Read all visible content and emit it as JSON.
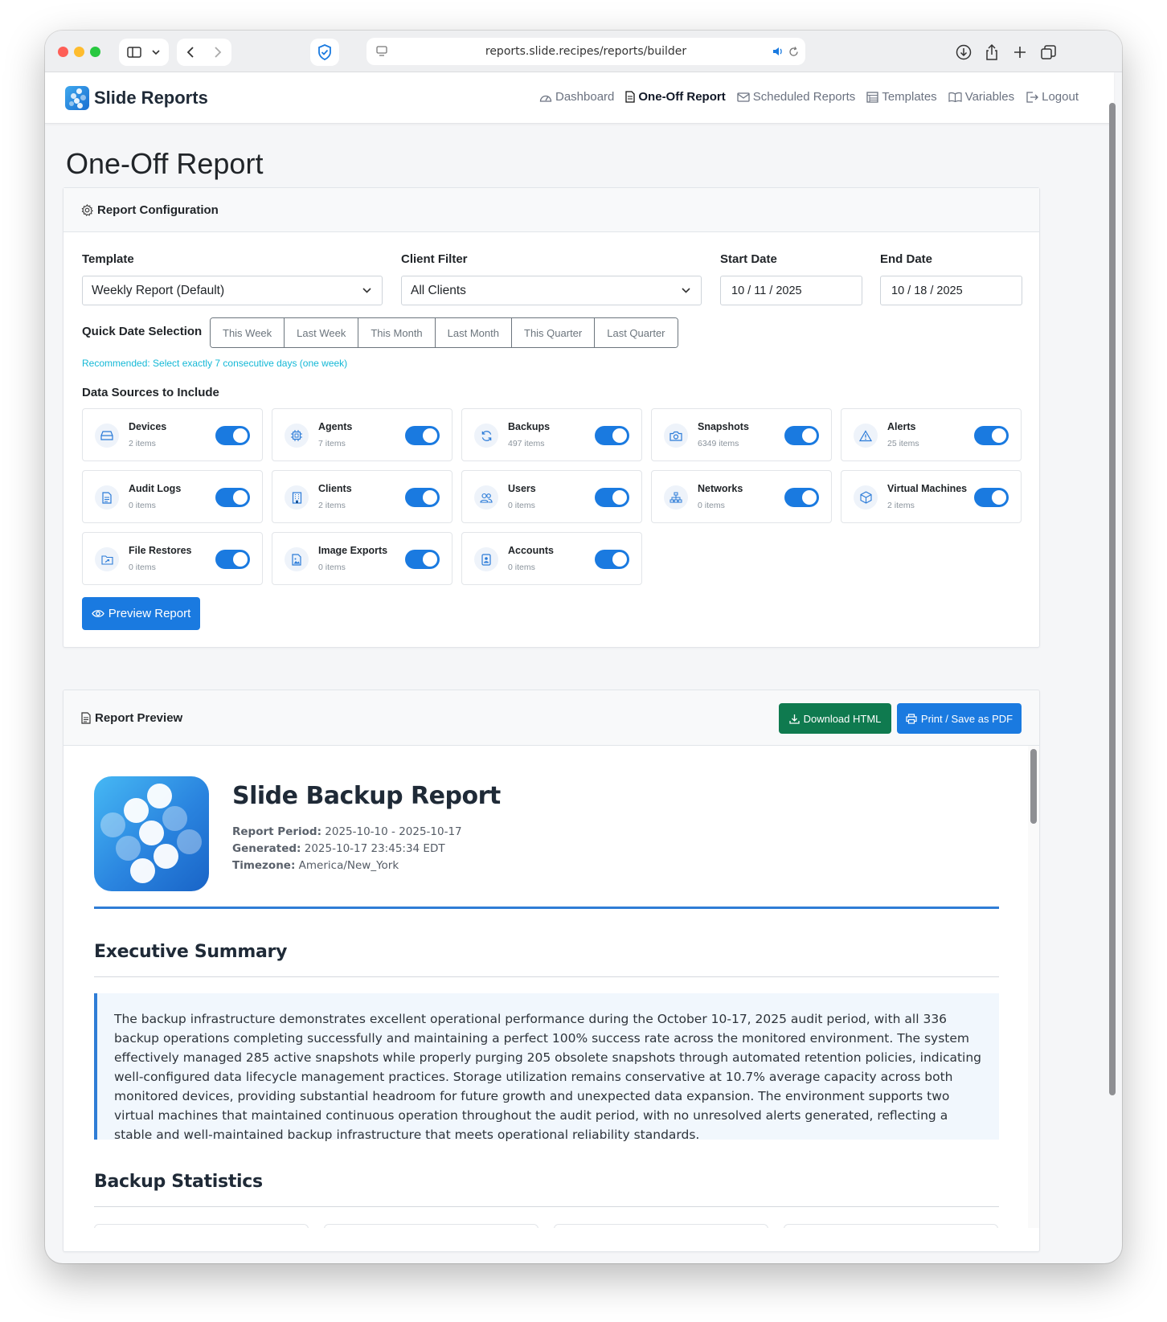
{
  "browser": {
    "url": "reports.slide.recipes/reports/builder"
  },
  "app": {
    "brand": "Slide Reports",
    "nav": [
      {
        "label": "Dashboard",
        "icon": "dashboard-icon"
      },
      {
        "label": "One-Off Report",
        "icon": "file-icon",
        "active": true
      },
      {
        "label": "Scheduled Reports",
        "icon": "envelope-icon"
      },
      {
        "label": "Templates",
        "icon": "table-icon"
      },
      {
        "label": "Variables",
        "icon": "book-icon"
      },
      {
        "label": "Logout",
        "icon": "logout-icon"
      }
    ]
  },
  "page": {
    "title": "One-Off Report"
  },
  "config": {
    "header": "Report Configuration",
    "template_label": "Template",
    "template_value": "Weekly Report (Default)",
    "client_label": "Client Filter",
    "client_value": "All Clients",
    "start_label": "Start Date",
    "start_value": "10 / 11 / 2025",
    "end_label": "End Date",
    "end_value": "10 / 18 / 2025",
    "quick_label": "Quick Date Selection",
    "quick_options": [
      "This Week",
      "Last Week",
      "This Month",
      "Last Month",
      "This Quarter",
      "Last Quarter"
    ],
    "hint": "Recommended: Select exactly 7 consecutive days (one week)",
    "sources_label": "Data Sources to Include",
    "sources": [
      {
        "name": "Devices",
        "count": "2 items",
        "icon": "drive-icon",
        "enabled": true
      },
      {
        "name": "Agents",
        "count": "7 items",
        "icon": "cpu-icon",
        "enabled": true
      },
      {
        "name": "Backups",
        "count": "497 items",
        "icon": "refresh-icon",
        "enabled": true
      },
      {
        "name": "Snapshots",
        "count": "6349 items",
        "icon": "camera-icon",
        "enabled": true
      },
      {
        "name": "Alerts",
        "count": "25 items",
        "icon": "warning-icon",
        "enabled": true
      },
      {
        "name": "Audit Logs",
        "count": "0 items",
        "icon": "document-icon",
        "enabled": true
      },
      {
        "name": "Clients",
        "count": "2 items",
        "icon": "building-icon",
        "enabled": true
      },
      {
        "name": "Users",
        "count": "0 items",
        "icon": "users-icon",
        "enabled": true
      },
      {
        "name": "Networks",
        "count": "0 items",
        "icon": "network-icon",
        "enabled": true
      },
      {
        "name": "Virtual Machines",
        "count": "2 items",
        "icon": "box-icon",
        "enabled": true
      },
      {
        "name": "File Restores",
        "count": "0 items",
        "icon": "folder-restore-icon",
        "enabled": true
      },
      {
        "name": "Image Exports",
        "count": "0 items",
        "icon": "image-file-icon",
        "enabled": true
      },
      {
        "name": "Accounts",
        "count": "0 items",
        "icon": "badge-icon",
        "enabled": true
      }
    ],
    "preview_button": "Preview Report"
  },
  "preview": {
    "header": "Report Preview",
    "download_button": "Download HTML",
    "print_button": "Print / Save as PDF",
    "report": {
      "title": "Slide Backup Report",
      "period_label": "Report Period:",
      "period_value": "2025-10-10 - 2025-10-17",
      "generated_label": "Generated:",
      "generated_value": "2025-10-17 23:45:34 EDT",
      "timezone_label": "Timezone:",
      "timezone_value": "America/New_York",
      "summary_heading": "Executive Summary",
      "summary_text": "The backup infrastructure demonstrates excellent operational performance during the October 10-17, 2025 audit period, with all 336 backup operations completing successfully and maintaining a perfect 100% success rate across the monitored environment. The system effectively managed 285 active snapshots while properly purging 205 obsolete snapshots through automated retention policies, indicating well-configured data lifecycle management practices. Storage utilization remains conservative at 10.7% average capacity across both monitored devices, providing substantial headroom for future growth and unexpected data expansion. The environment supports two virtual machines that maintained continuous operation throughout the audit period, with no unresolved alerts generated, reflecting a stable and well-maintained backup infrastructure that meets operational reliability standards.",
      "stats_heading": "Backup Statistics"
    }
  }
}
